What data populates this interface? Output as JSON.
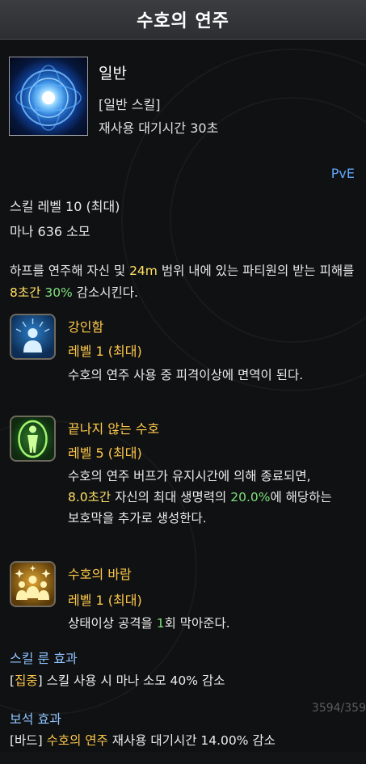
{
  "title": "수호의 연주",
  "skill": {
    "icon": "guardian-tune-skill-icon",
    "grade": "일반",
    "type": "[일반 스킬]",
    "cooldown": "재사용 대기시간 30초",
    "mode": "PvE",
    "level": "스킬 레벨 10 (최대)",
    "mana": "마나 636 소모",
    "desc": {
      "p1": "하프를 연주해 자신 및 ",
      "range": "24m",
      "p2": " 범위 내에 있는 파티원의 받는 피해를 ",
      "duration": "8초간",
      "p3": " ",
      "reduction": "30%",
      "p4": " 감소시킨다."
    }
  },
  "tripods": [
    {
      "icon": "figure-halo-icon",
      "name": "강인함",
      "level": "레벨 1 (최대)",
      "desc": "수호의 연주 사용 중 피격이상에 면역이 된다."
    },
    {
      "icon": "green-aura-figure-icon",
      "name": "끝나지 않는 수호",
      "level": "레벨 5 (최대)",
      "desc": {
        "p1": "수호의 연주 버프가 유지시간에 의해 종료되면, ",
        "time": "8.0초간",
        "p2": " 자신의 최대 생명력의 ",
        "pct": "20.0%",
        "p3": "에 해당하는 보호막을 추가로 생성한다."
      }
    },
    {
      "icon": "party-sparkle-icon",
      "name": "수호의 바람",
      "level": "레벨 1 (최대)",
      "desc": {
        "p1": "상태이상 공격을 ",
        "count": "1",
        "p2": "회 막아준다."
      }
    }
  ],
  "rune": {
    "heading": "스킬 룬 효과",
    "name": "집중",
    "bracket_open": "[",
    "bracket_close": "]",
    "text": " 스킬 사용 시 마나 소모 40% 감소"
  },
  "gem": {
    "heading": "보석 효과",
    "class_tag": "[바드]",
    "skill_name": "수호의 연주",
    "text": " 재사용 대기시간 14.00% 감소"
  },
  "background_hp_text": "3594/359",
  "colors": {
    "highlight_yellow": "#ffe066",
    "highlight_green": "#7ee07e",
    "tripod_gold": "#ffc94a",
    "section_blue": "#8fc4ff",
    "pve_blue": "#5fa8ff"
  }
}
